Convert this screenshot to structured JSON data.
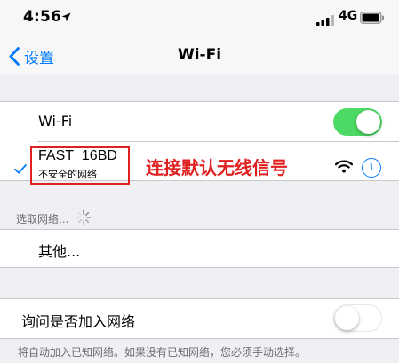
{
  "status_bar": {
    "time": "4:56",
    "network": "4G",
    "icons": [
      "location-arrow-icon",
      "signal-bars-icon",
      "battery-icon"
    ]
  },
  "nav": {
    "back_label": "设置",
    "title": "Wi-Fi"
  },
  "wifi_toggle": {
    "label": "Wi-Fi",
    "state": "on"
  },
  "connected_network": {
    "name": "FAST_16BD",
    "security_note": "不安全的网络",
    "icons": [
      "checkmark-icon",
      "wifi-signal-icon",
      "info-icon"
    ]
  },
  "annotation": {
    "text": "连接默认无线信号",
    "color": "#e02020"
  },
  "choose_network": {
    "header": "选取网络..."
  },
  "other_network": {
    "label": "其他..."
  },
  "ask_to_join": {
    "label": "询问是否加入网络",
    "state": "off"
  },
  "footer": {
    "note": "将自动加入已知网络。如果没有已知网络，您必须手动选择。"
  },
  "colors": {
    "accent": "#007aff",
    "toggle_on": "#4cd964",
    "annotation": "#e02020",
    "background": "#efeff4"
  }
}
